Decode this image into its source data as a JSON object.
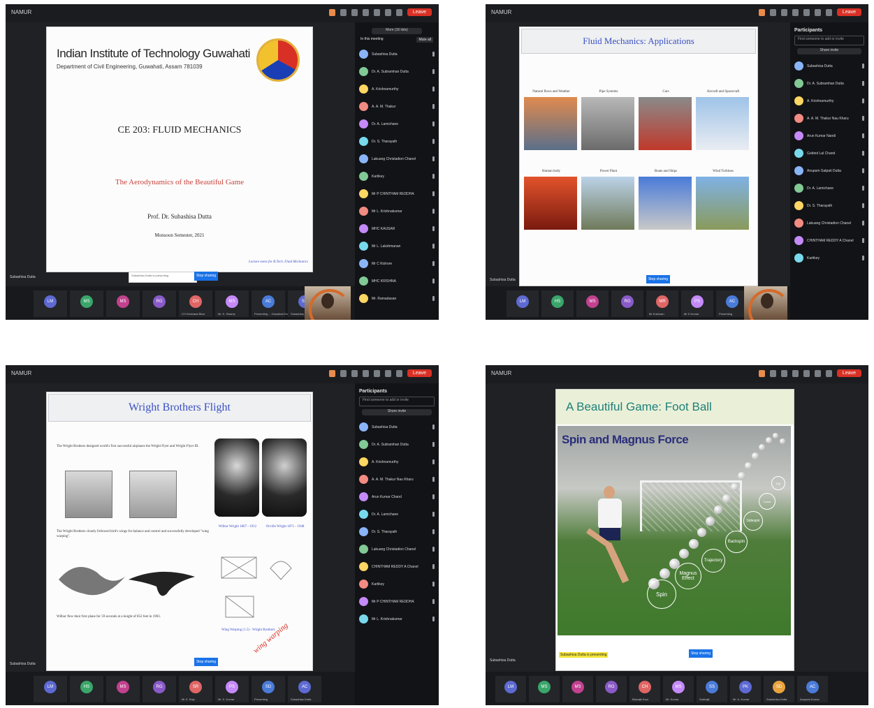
{
  "p1": {
    "meeting_title": "NAMUR",
    "leave_label": "Leave",
    "more": "More (16 lists)",
    "in_meeting": "In this meeting",
    "mute_all": "Mute all",
    "slide": {
      "institute": "Indian Institute of Technology Guwahati",
      "dept": "Department of Civil Engineering, Guwahati, Assam 781039",
      "course": "CE 203: FLUID MECHANICS",
      "subtitle": "The Aerodynamics of the Beautiful Game",
      "prof": "Prof. Dr. Subashisa Dutta",
      "semester": "Monsoon Semester, 2021",
      "footer": "Lecture notes for B.Tech. Fluid Mechanics",
      "present_btn": "Stop sharing",
      "share_note": "Subashisa Dutta is presenting"
    },
    "participants": [
      "Subashisa Dutta",
      "Dr. A. Subramhan Dutta",
      "A. Krishnamurthy",
      "A. A. M. Thakur",
      "Dr. A. Lamichane",
      "Dr. S. Tharayath",
      "Lakuang Christadion Chanel",
      "Kartikey",
      "Mr P CHINTHAM REDDHA",
      "Mr L. Krishnakumar",
      "MHC KAUSAR",
      "Mr L. Lakshmanan",
      "Mr C Kishore",
      "MHC KRISHNA",
      "Mr. Ramadasan"
    ],
    "tiles": [
      {
        "initials": "LM",
        "caption": ""
      },
      {
        "initials": "MS",
        "caption": ""
      },
      {
        "initials": "MS",
        "caption": ""
      },
      {
        "initials": "RG",
        "caption": ""
      },
      {
        "initials": "CH",
        "caption": "CH Srinivasa Bhat"
      },
      {
        "initials": "MS",
        "caption": "Mr. K. Swamy"
      },
      {
        "initials": "AC",
        "caption": "Presenting ... Guwahati Dutta"
      },
      {
        "initials": "SD",
        "caption": "Subashisa Dutta"
      }
    ],
    "self_label": "Subashisa Dutta"
  },
  "p2": {
    "meeting_title": "NAMUR",
    "leave_label": "Leave",
    "participants_label": "Participants",
    "search_placeholder": "Find someone to add or invite",
    "share_invite": "Share invite",
    "slide_title": "Fluid Mechanics: Applications",
    "apps": [
      "Natural flows and Weather",
      "Pipe Systems",
      "Cars",
      "Aircraft and Spacecraft",
      "Human body",
      "Power Plant",
      "Boats and Ships",
      "Wind Turbines"
    ],
    "present_btn": "Stop sharing",
    "participants": [
      "Subashisa Dutta",
      "Dr. A. Subramhan Dutta",
      "A. Krishnamurthy",
      "A. A. M. Thakur Nau Kharu",
      "Arun Kumar Nandi",
      "Gobind Lal Chand",
      "Anupam Satpati Dutta",
      "Dr. A. Lamichane",
      "Dr. S. Tharayath",
      "Lakuang Christadion Chanel",
      "CHINTHAM REDDY A Chanel",
      "Kartikey"
    ],
    "tiles": [
      {
        "initials": "LM",
        "caption": ""
      },
      {
        "initials": "HS",
        "caption": ""
      },
      {
        "initials": "MS",
        "caption": ""
      },
      {
        "initials": "RG",
        "caption": ""
      },
      {
        "initials": "MR",
        "caption": "Mr Krishnan"
      },
      {
        "initials": "PS",
        "caption": "Mr K Kumar"
      },
      {
        "initials": "AC",
        "caption": "Presenting"
      },
      {
        "initials": "SD",
        "caption": "Subashisa Dutta"
      }
    ],
    "self_label": "Subashisa Dutta"
  },
  "p3": {
    "meeting_title": "NAMUR",
    "leave_label": "Leave",
    "participants_label": "Participants",
    "search_placeholder": "Find someone to add or invite",
    "share_invite": "Share invite",
    "slide_title": "Wright Brothers Flight",
    "bullets": [
      "The Wright Brothers designed world's first successful airplanes the Wright Flyer and Wright Flyer III.",
      "The Wright Brothers closely followed bird's wings for balance and control and successfully developed \"wing warping\".",
      "Wilbur flew their first plane for 59 seconds at a height of 852 feet in 1903."
    ],
    "wilbur": "Wilbur Wright 1867 - 1912",
    "orville": "Orville Wright 1871 - 1948",
    "wing_caption": "Wing Warping (1.5) - Wright Brothers",
    "handwriting": "wing warping",
    "present_btn": "Stop sharing",
    "participants": [
      "Subashisa Dutta",
      "Dr. A. Subramhan Dutta",
      "A. Krishnamurthy",
      "A. A. M. Thakur Nau Kharu",
      "Arun Kumar Chand",
      "Dr. A. Lamichane",
      "Dr. S. Tharayath",
      "Lakuang Christadion Chanel",
      "CHINTHAM REDDY A Chanel",
      "Kartikey",
      "Mr P CHINTHAM REDDHA",
      "Mr L. Krishnakumar"
    ],
    "tiles": [
      {
        "initials": "LM",
        "caption": ""
      },
      {
        "initials": "HS",
        "caption": ""
      },
      {
        "initials": "MS",
        "caption": ""
      },
      {
        "initials": "RG",
        "caption": ""
      },
      {
        "initials": "SR",
        "caption": "Mr S. Raju"
      },
      {
        "initials": "PS",
        "caption": "Mr. K. Kumar"
      },
      {
        "initials": "SD",
        "caption": "Presenting"
      },
      {
        "initials": "AC",
        "caption": "Subashisa Dutta"
      }
    ],
    "self_label": "Subashisa Dutta"
  },
  "p4": {
    "meeting_title": "NAMUR",
    "leave_label": "Leave",
    "slide_title": "A Beautiful Game: Foot Ball",
    "image_heading": "Spin and Magnus Force",
    "ring_labels": [
      "Spin",
      "Magnus Effect",
      "Trajectory",
      "Backspin",
      "Sidespin",
      "Curve",
      "Dip"
    ],
    "share_note": "Subashisa Dutta is presenting",
    "present_btn": "Stop sharing",
    "tiles": [
      {
        "initials": "LM",
        "caption": ""
      },
      {
        "initials": "MS",
        "caption": ""
      },
      {
        "initials": "MS",
        "caption": ""
      },
      {
        "initials": "RG",
        "caption": ""
      },
      {
        "initials": "CH",
        "caption": "Biswajit Kaur"
      },
      {
        "initials": "MS",
        "caption": "Mr. Kumar"
      },
      {
        "initials": "SS",
        "caption": "Subhajit"
      },
      {
        "initials": "PK",
        "caption": "Mr. K. Kumar"
      },
      {
        "initials": "SD",
        "caption": "Subashisa Dutta"
      },
      {
        "initials": "AC",
        "caption": "Anupam Kumar"
      }
    ],
    "self_label": "Subashisa Dutta"
  }
}
